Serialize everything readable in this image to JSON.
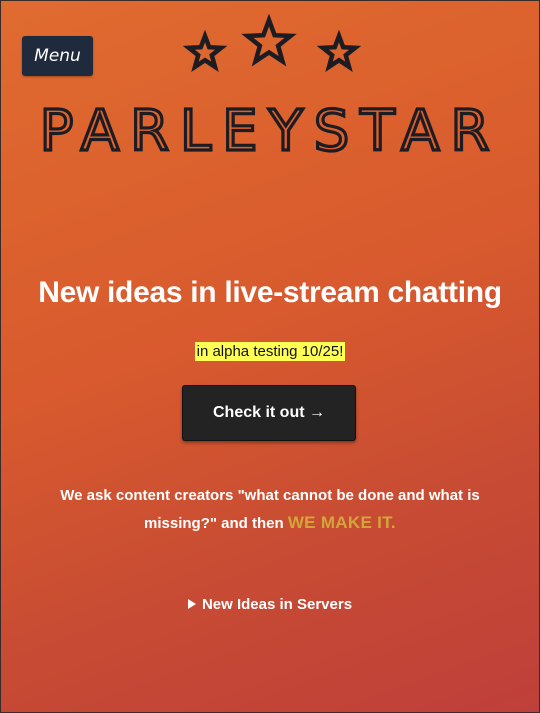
{
  "nav": {
    "menu_label": "Menu"
  },
  "brand": {
    "name": "PARLEYSTAR",
    "logo_color": "#1c1c22",
    "star_icon": "star-outline-icon"
  },
  "hero": {
    "headline": "New ideas in live-stream chatting",
    "badge": "in alpha testing 10/25!",
    "badge_color": "#ffff55",
    "cta_label": "Check it out →",
    "cta_color": "#232323"
  },
  "pitch": {
    "text": "We ask content creators \"what cannot be done and what is missing?\" and then",
    "accent": "WE MAKE IT.",
    "accent_color": "#d4a63a"
  },
  "details": {
    "summary": "New Ideas in Servers",
    "expanded": false
  },
  "theme": {
    "gradient_start": "#e06b2f",
    "gradient_end": "#bf3f3a"
  }
}
